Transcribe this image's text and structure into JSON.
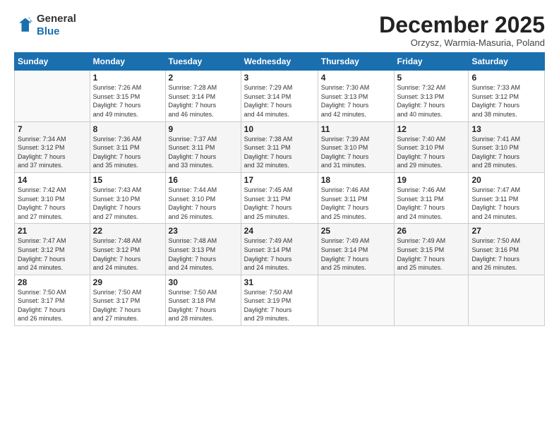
{
  "logo": {
    "general": "General",
    "blue": "Blue"
  },
  "header": {
    "month_title": "December 2025",
    "subtitle": "Orzysz, Warmia-Masuria, Poland"
  },
  "days_of_week": [
    "Sunday",
    "Monday",
    "Tuesday",
    "Wednesday",
    "Thursday",
    "Friday",
    "Saturday"
  ],
  "weeks": [
    [
      {
        "day": "",
        "info": ""
      },
      {
        "day": "1",
        "info": "Sunrise: 7:26 AM\nSunset: 3:15 PM\nDaylight: 7 hours\nand 49 minutes."
      },
      {
        "day": "2",
        "info": "Sunrise: 7:28 AM\nSunset: 3:14 PM\nDaylight: 7 hours\nand 46 minutes."
      },
      {
        "day": "3",
        "info": "Sunrise: 7:29 AM\nSunset: 3:14 PM\nDaylight: 7 hours\nand 44 minutes."
      },
      {
        "day": "4",
        "info": "Sunrise: 7:30 AM\nSunset: 3:13 PM\nDaylight: 7 hours\nand 42 minutes."
      },
      {
        "day": "5",
        "info": "Sunrise: 7:32 AM\nSunset: 3:13 PM\nDaylight: 7 hours\nand 40 minutes."
      },
      {
        "day": "6",
        "info": "Sunrise: 7:33 AM\nSunset: 3:12 PM\nDaylight: 7 hours\nand 38 minutes."
      }
    ],
    [
      {
        "day": "7",
        "info": "Sunrise: 7:34 AM\nSunset: 3:12 PM\nDaylight: 7 hours\nand 37 minutes."
      },
      {
        "day": "8",
        "info": "Sunrise: 7:36 AM\nSunset: 3:11 PM\nDaylight: 7 hours\nand 35 minutes."
      },
      {
        "day": "9",
        "info": "Sunrise: 7:37 AM\nSunset: 3:11 PM\nDaylight: 7 hours\nand 33 minutes."
      },
      {
        "day": "10",
        "info": "Sunrise: 7:38 AM\nSunset: 3:11 PM\nDaylight: 7 hours\nand 32 minutes."
      },
      {
        "day": "11",
        "info": "Sunrise: 7:39 AM\nSunset: 3:10 PM\nDaylight: 7 hours\nand 31 minutes."
      },
      {
        "day": "12",
        "info": "Sunrise: 7:40 AM\nSunset: 3:10 PM\nDaylight: 7 hours\nand 29 minutes."
      },
      {
        "day": "13",
        "info": "Sunrise: 7:41 AM\nSunset: 3:10 PM\nDaylight: 7 hours\nand 28 minutes."
      }
    ],
    [
      {
        "day": "14",
        "info": "Sunrise: 7:42 AM\nSunset: 3:10 PM\nDaylight: 7 hours\nand 27 minutes."
      },
      {
        "day": "15",
        "info": "Sunrise: 7:43 AM\nSunset: 3:10 PM\nDaylight: 7 hours\nand 27 minutes."
      },
      {
        "day": "16",
        "info": "Sunrise: 7:44 AM\nSunset: 3:10 PM\nDaylight: 7 hours\nand 26 minutes."
      },
      {
        "day": "17",
        "info": "Sunrise: 7:45 AM\nSunset: 3:11 PM\nDaylight: 7 hours\nand 25 minutes."
      },
      {
        "day": "18",
        "info": "Sunrise: 7:46 AM\nSunset: 3:11 PM\nDaylight: 7 hours\nand 25 minutes."
      },
      {
        "day": "19",
        "info": "Sunrise: 7:46 AM\nSunset: 3:11 PM\nDaylight: 7 hours\nand 24 minutes."
      },
      {
        "day": "20",
        "info": "Sunrise: 7:47 AM\nSunset: 3:11 PM\nDaylight: 7 hours\nand 24 minutes."
      }
    ],
    [
      {
        "day": "21",
        "info": "Sunrise: 7:47 AM\nSunset: 3:12 PM\nDaylight: 7 hours\nand 24 minutes."
      },
      {
        "day": "22",
        "info": "Sunrise: 7:48 AM\nSunset: 3:12 PM\nDaylight: 7 hours\nand 24 minutes."
      },
      {
        "day": "23",
        "info": "Sunrise: 7:48 AM\nSunset: 3:13 PM\nDaylight: 7 hours\nand 24 minutes."
      },
      {
        "day": "24",
        "info": "Sunrise: 7:49 AM\nSunset: 3:14 PM\nDaylight: 7 hours\nand 24 minutes."
      },
      {
        "day": "25",
        "info": "Sunrise: 7:49 AM\nSunset: 3:14 PM\nDaylight: 7 hours\nand 25 minutes."
      },
      {
        "day": "26",
        "info": "Sunrise: 7:49 AM\nSunset: 3:15 PM\nDaylight: 7 hours\nand 25 minutes."
      },
      {
        "day": "27",
        "info": "Sunrise: 7:50 AM\nSunset: 3:16 PM\nDaylight: 7 hours\nand 26 minutes."
      }
    ],
    [
      {
        "day": "28",
        "info": "Sunrise: 7:50 AM\nSunset: 3:17 PM\nDaylight: 7 hours\nand 26 minutes."
      },
      {
        "day": "29",
        "info": "Sunrise: 7:50 AM\nSunset: 3:17 PM\nDaylight: 7 hours\nand 27 minutes."
      },
      {
        "day": "30",
        "info": "Sunrise: 7:50 AM\nSunset: 3:18 PM\nDaylight: 7 hours\nand 28 minutes."
      },
      {
        "day": "31",
        "info": "Sunrise: 7:50 AM\nSunset: 3:19 PM\nDaylight: 7 hours\nand 29 minutes."
      },
      {
        "day": "",
        "info": ""
      },
      {
        "day": "",
        "info": ""
      },
      {
        "day": "",
        "info": ""
      }
    ]
  ]
}
